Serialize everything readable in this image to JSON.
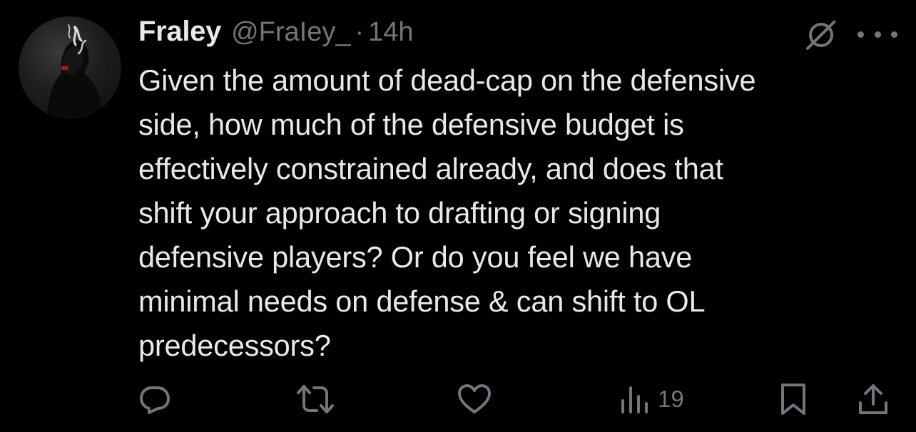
{
  "tweet": {
    "display_name": "Fraley",
    "handle": "@FraIey_",
    "separator": "·",
    "time": "14h",
    "lines": [
      "Given the amount of dead-cap on the defensive",
      "side, how much of the defensive budget is",
      "effectively constrained already, and does that",
      "shift your approach to drafting or signing",
      "defensive players? Or do you feel we have",
      "minimal needs on defense & can shift to OL",
      "predecessors?"
    ]
  },
  "actions": {
    "views_count": "19",
    "icons": [
      "reply-icon",
      "retweet-icon",
      "like-icon",
      "views-icon",
      "bookmark-icon",
      "share-icon"
    ]
  },
  "colors": {
    "background": "#000000",
    "text": "#e7e9ea",
    "muted": "#71767b"
  }
}
